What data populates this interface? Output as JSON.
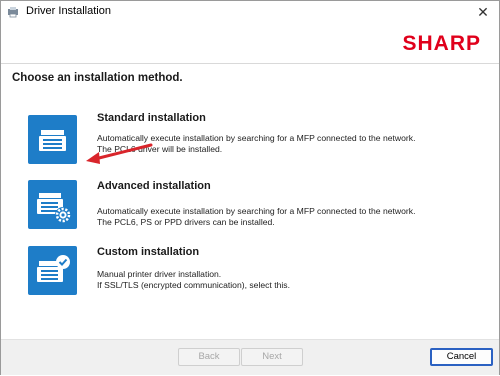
{
  "window": {
    "title": "Driver Installation",
    "close_glyph": "✕"
  },
  "brand": {
    "logo_text": "SHARP",
    "logo_color": "#e0001b"
  },
  "heading": "Choose an installation method.",
  "options": [
    {
      "title": "Standard installation",
      "desc1": "Automatically execute installation by searching for a MFP connected to the network.",
      "desc2": "The PCL6 driver will be installed.",
      "icon": "printer-icon"
    },
    {
      "title": "Advanced installation",
      "desc1": "Automatically execute installation by searching for a MFP connected to the network.",
      "desc2": "The PCL6, PS or PPD drivers can be installed.",
      "icon": "printer-gear-icon"
    },
    {
      "title": "Custom installation",
      "desc1": "Manual printer driver installation.",
      "desc2": "If SSL/TLS (encrypted communication), select this.",
      "icon": "printer-check-icon"
    }
  ],
  "buttons": {
    "back": "Back",
    "next": "Next",
    "cancel": "Cancel"
  },
  "colors": {
    "icon_bg": "#1e7dc8",
    "annotation_arrow": "#d9252b",
    "focus_border": "#2b61c2"
  }
}
